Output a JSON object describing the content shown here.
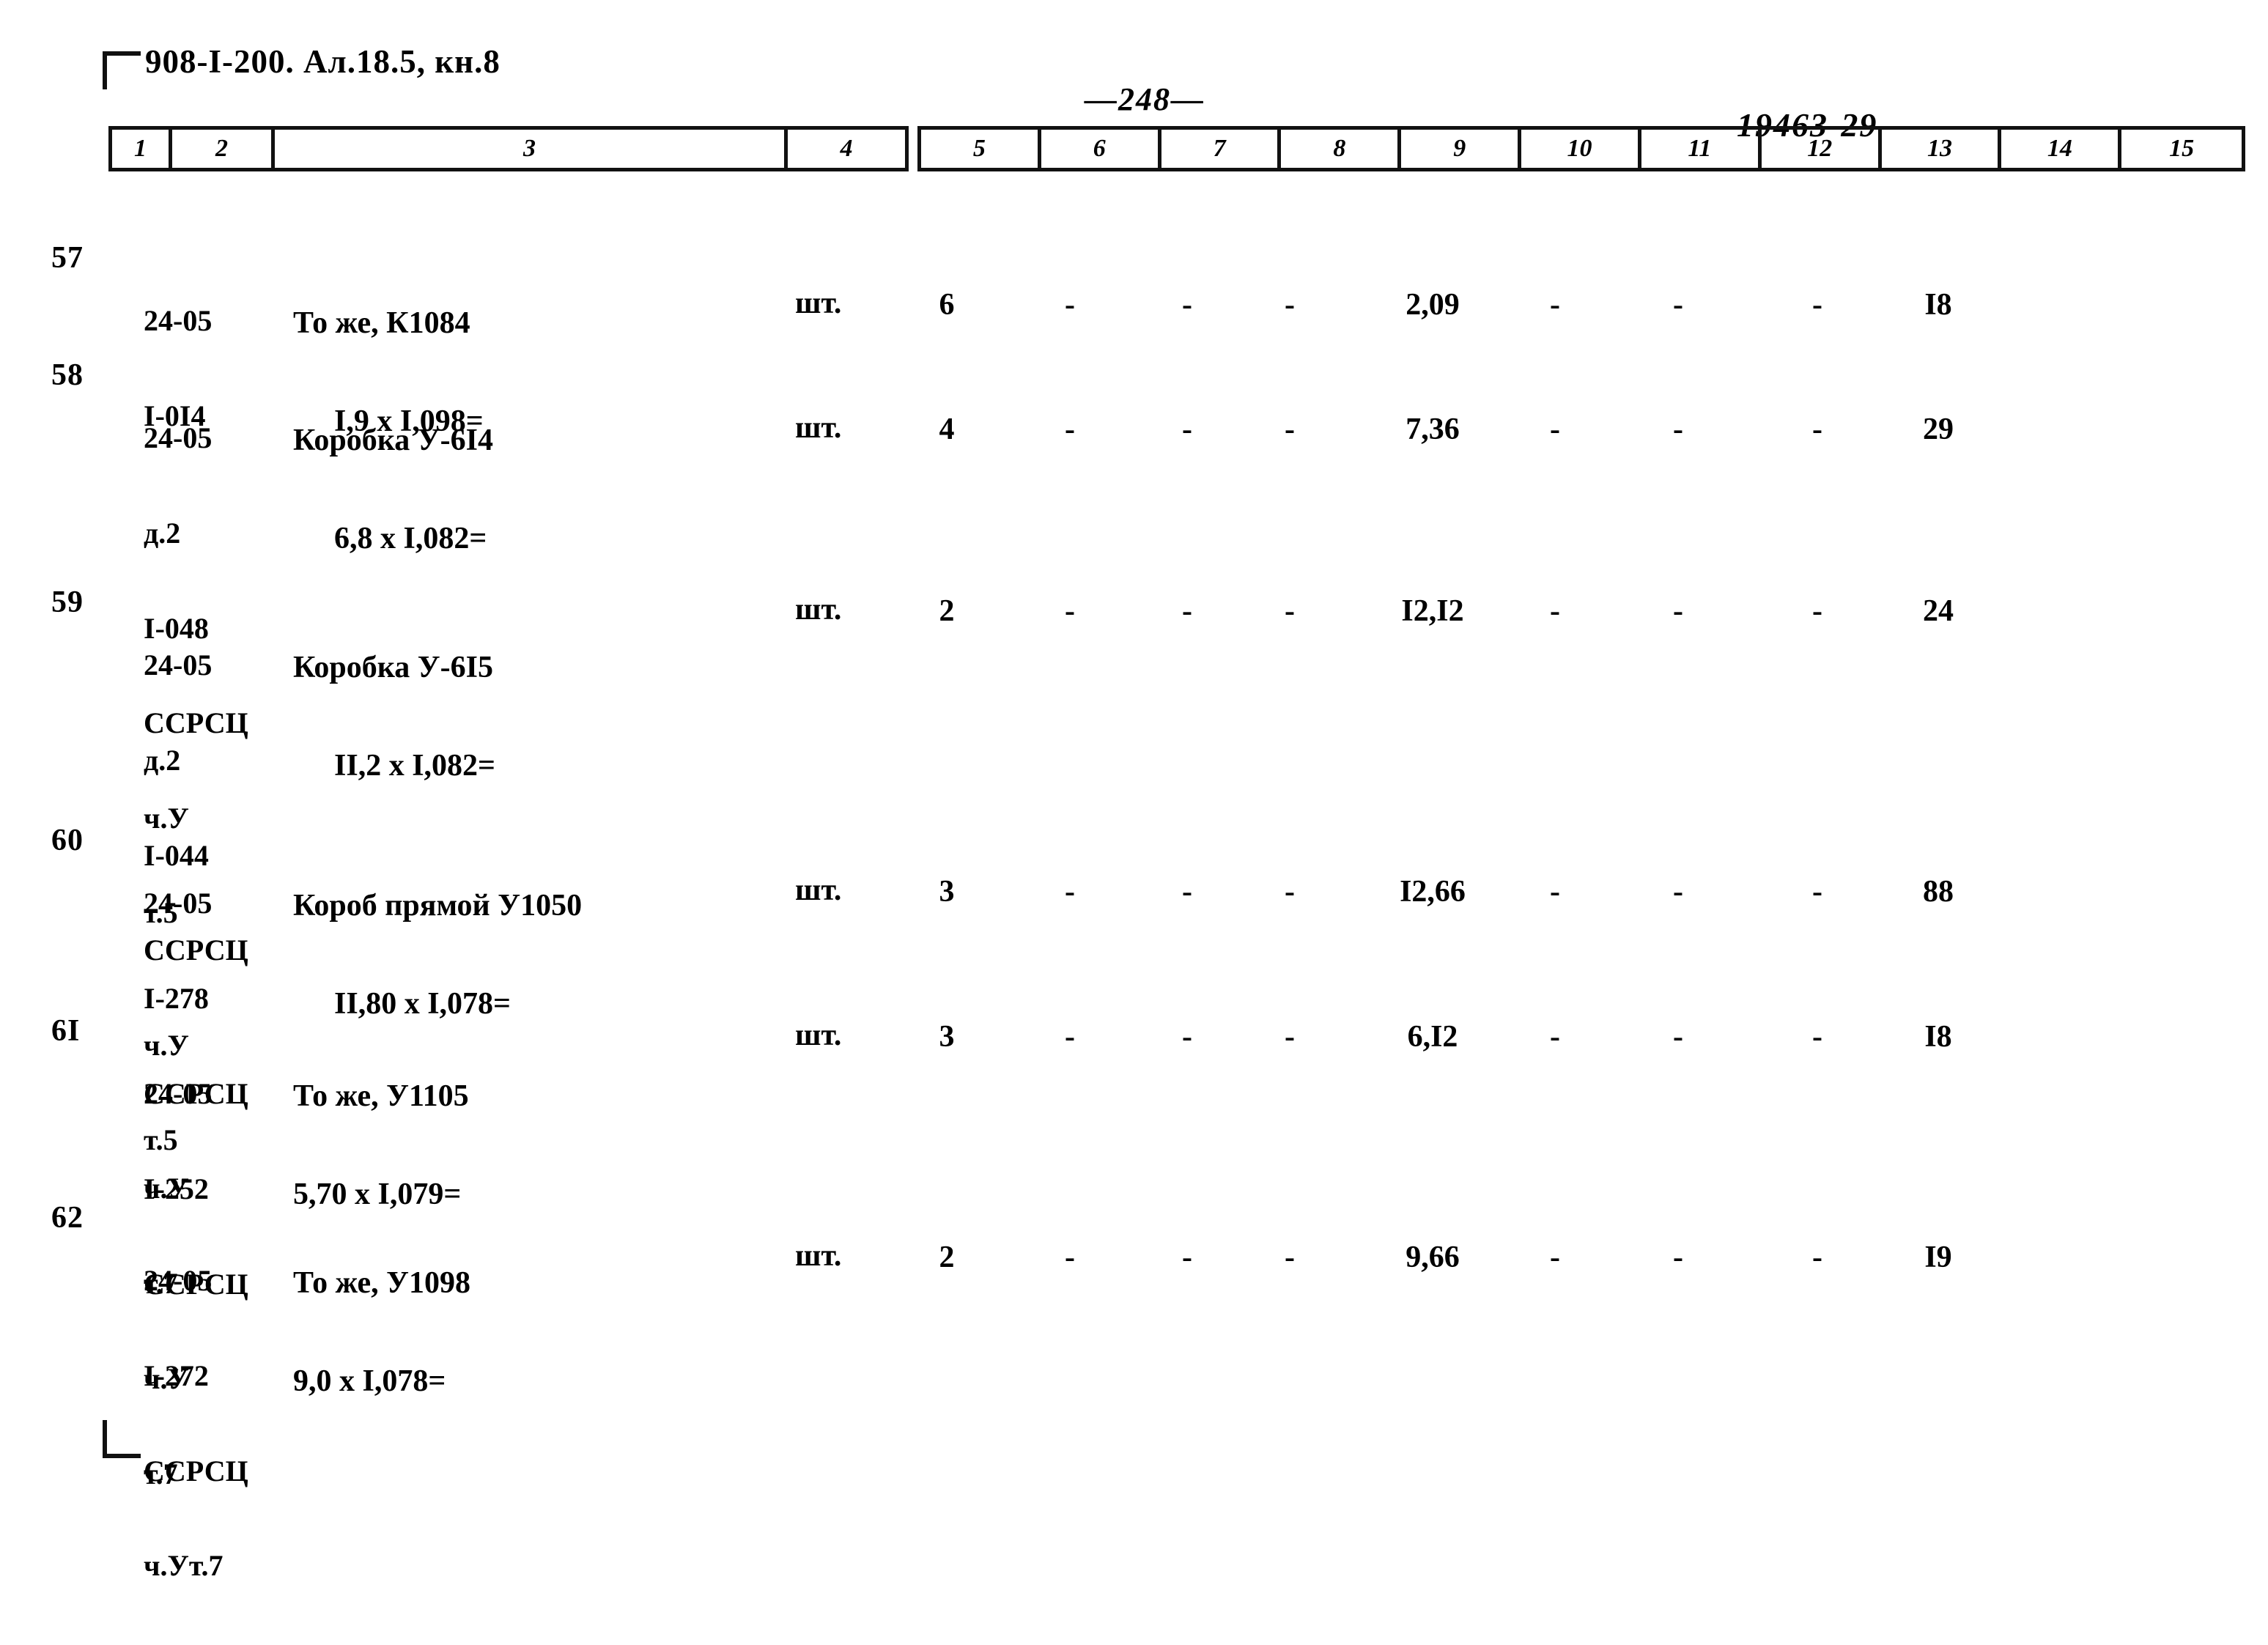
{
  "document": {
    "doc_code": "908-I-200.  Ал.18.5, кн.8",
    "page_number": "—248—",
    "sheet_code": "19463-29"
  },
  "table": {
    "column_headers_left": [
      "1",
      "2",
      "3",
      "4"
    ],
    "column_headers_right": [
      "5",
      "6",
      "7",
      "8",
      "9",
      "10",
      "11",
      "12",
      "13",
      "14",
      "15"
    ],
    "rows": [
      {
        "num": "57",
        "code_lines": [
          "24-05",
          "I-0I4"
        ],
        "name_line1": "То же, К1084",
        "name_line2": "I,9 х I,098=",
        "unit": "шт.",
        "c5": "6",
        "c6": "-",
        "c7": "-",
        "c8": "-",
        "c9": "2,09",
        "c10": "-",
        "c11": "-",
        "c12": "-",
        "c13": "I8",
        "c14": "",
        "c15": ""
      },
      {
        "num": "58",
        "code_lines": [
          "24-05",
          "д.2",
          "I-048",
          "ССРСЦ",
          "ч.У",
          "т.5"
        ],
        "name_line1": "Коробка У-6I4",
        "name_line2": "6,8 х I,082=",
        "unit": "шт.",
        "c5": "4",
        "c6": "-",
        "c7": "-",
        "c8": "-",
        "c9": "7,36",
        "c10": "-",
        "c11": "-",
        "c12": "-",
        "c13": "29",
        "c14": "",
        "c15": ""
      },
      {
        "num": "59",
        "code_lines": [
          "24-05",
          "д.2",
          "I-044",
          "ССРСЦ",
          "ч.У",
          "т.5"
        ],
        "name_line1": "Коробка У-6I5",
        "name_line2": "II,2 х I,082=",
        "unit": "шт.",
        "c5": "2",
        "c6": "-",
        "c7": "-",
        "c8": "-",
        "c9": "I2,I2",
        "c10": "-",
        "c11": "-",
        "c12": "-",
        "c13": "24",
        "c14": "",
        "c15": ""
      },
      {
        "num": "60",
        "code_lines": [
          "24-05",
          "I-278",
          "ССРСЦ",
          "ч.У",
          "т.7"
        ],
        "name_line1": "Короб прямой У1050",
        "name_line2": "II,80 х I,078=",
        "unit": "шт.",
        "c5": "3",
        "c6": "-",
        "c7": "-",
        "c8": "-",
        "c9": "I2,66",
        "c10": "-",
        "c11": "-",
        "c12": "-",
        "c13": "88",
        "c14": "",
        "c15": ""
      },
      {
        "num": "6I",
        "code_lines": [
          "24-05",
          "I-252",
          "ССРСЦ",
          "ч.У",
          "т.7"
        ],
        "name_line1": "То же, У1105",
        "name_line2": "5,70 х I,079=",
        "unit": "шт.",
        "c5": "3",
        "c6": "-",
        "c7": "-",
        "c8": "-",
        "c9": "6,I2",
        "c10": "-",
        "c11": "-",
        "c12": "-",
        "c13": "I8",
        "c14": "",
        "c15": ""
      },
      {
        "num": "62",
        "code_lines": [
          "24-05",
          "I-272",
          "ССРСЦ",
          "ч.Ут.7"
        ],
        "name_line1": "То же, У1098",
        "name_line2": "9,0 х I,078=",
        "unit": "шт.",
        "c5": "2",
        "c6": "-",
        "c7": "-",
        "c8": "-",
        "c9": "9,66",
        "c10": "-",
        "c11": "-",
        "c12": "-",
        "c13": "I9",
        "c14": "",
        "c15": ""
      }
    ]
  }
}
